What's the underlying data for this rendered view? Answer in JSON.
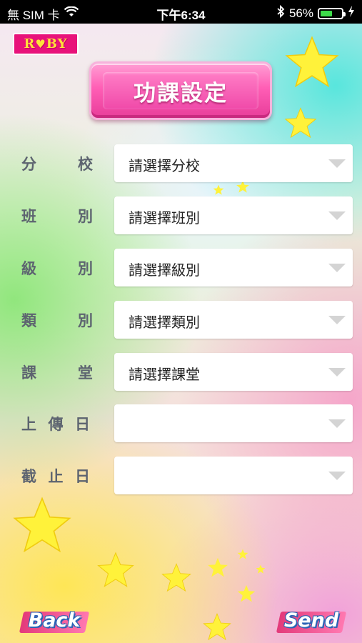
{
  "status_bar": {
    "carrier": "無 SIM 卡",
    "time": "下午6:34",
    "battery": "56%",
    "battery_level": 0.56
  },
  "logo": {
    "text": "RUBY"
  },
  "title": "功課設定",
  "form": {
    "rows": [
      {
        "label_chars": [
          "分",
          "校"
        ],
        "value": "請選擇分校"
      },
      {
        "label_chars": [
          "班",
          "別"
        ],
        "value": "請選擇班別"
      },
      {
        "label_chars": [
          "級",
          "別"
        ],
        "value": "請選擇級別"
      },
      {
        "label_chars": [
          "類",
          "別"
        ],
        "value": "請選擇類別"
      },
      {
        "label_chars": [
          "課",
          "堂"
        ],
        "value": "請選擇課堂"
      },
      {
        "label_chars": [
          "上",
          "傳",
          "日"
        ],
        "value": ""
      },
      {
        "label_chars": [
          "截",
          "止",
          "日"
        ],
        "value": ""
      }
    ]
  },
  "buttons": {
    "back": "Back",
    "send": "Send"
  },
  "colors": {
    "title_pink": "#f04aa9",
    "label_gray": "#5d6470",
    "star_yellow": "#fff23a",
    "logo_magenta": "#e8127a"
  }
}
